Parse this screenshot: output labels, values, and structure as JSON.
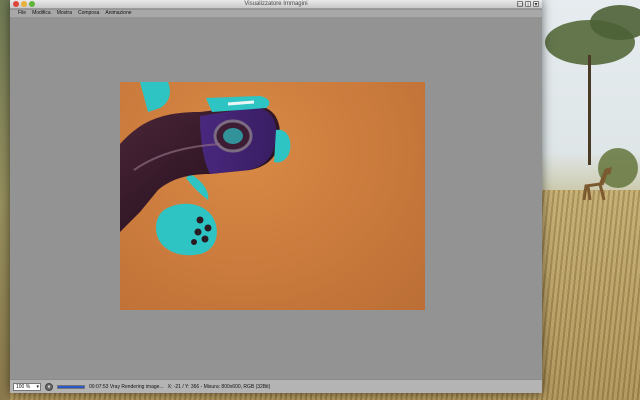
{
  "window": {
    "title": "Visualizzatore Immagini"
  },
  "menu": {
    "items": [
      "File",
      "Modifica",
      "Mostra",
      "Composa",
      "Animazione"
    ]
  },
  "statusbar": {
    "zoom": "100 %",
    "progress_fraction": 1.0,
    "render_status": "00:07:53 Vray Rendering image...",
    "coords": "X: -21 / Y: 366 - Misura: 800x600, RGB (32Bit)"
  },
  "colors": {
    "render_background": "#cc7d3e",
    "object_body": "#3a1c2a",
    "object_accent": "#2ec4c4"
  },
  "icons": {
    "close": "close-icon",
    "minimize": "minimize-icon",
    "maximize": "maximize-icon"
  }
}
